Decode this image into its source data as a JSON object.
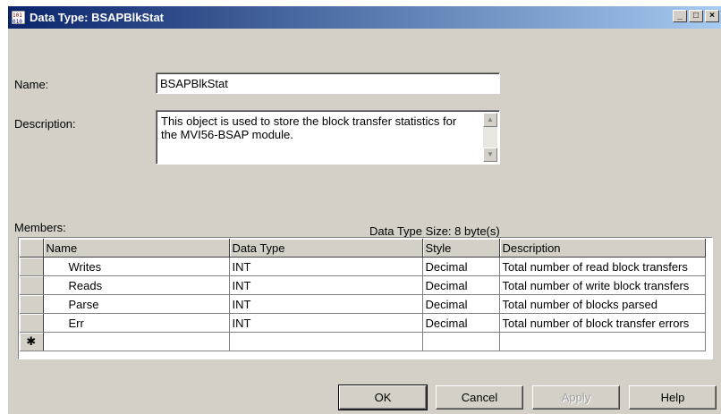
{
  "window": {
    "title": "Data Type: BSAPBlkStat",
    "buttons": {
      "minimize": "_",
      "maximize": "□",
      "close": "×"
    }
  },
  "form": {
    "name_label": "Name:",
    "name_value": "BSAPBlkStat",
    "description_label": "Description:",
    "description_value": "This object is used to store the block transfer statistics for the MVI56-BSAP module."
  },
  "members": {
    "label": "Members:",
    "size_text": "Data Type Size: 8 byte(s)",
    "columns": [
      "Name",
      "Data Type",
      "Style",
      "Description"
    ],
    "rows": [
      {
        "name": "Writes",
        "type": "INT",
        "style": "Decimal",
        "description": "Total number of read block transfers"
      },
      {
        "name": "Reads",
        "type": "INT",
        "style": "Decimal",
        "description": "Total number of write block transfers"
      },
      {
        "name": "Parse",
        "type": "INT",
        "style": "Decimal",
        "description": "Total number of blocks parsed"
      },
      {
        "name": "Err",
        "type": "INT",
        "style": "Decimal",
        "description": "Total number of block transfer errors"
      }
    ],
    "new_row_marker": "✱"
  },
  "actions": {
    "ok": "OK",
    "cancel": "Cancel",
    "apply": "Apply",
    "help": "Help"
  },
  "colors": {
    "titlebar_start": "#0a246a",
    "titlebar_end": "#a6caf0",
    "dialog_bg": "#d4d0c8"
  }
}
